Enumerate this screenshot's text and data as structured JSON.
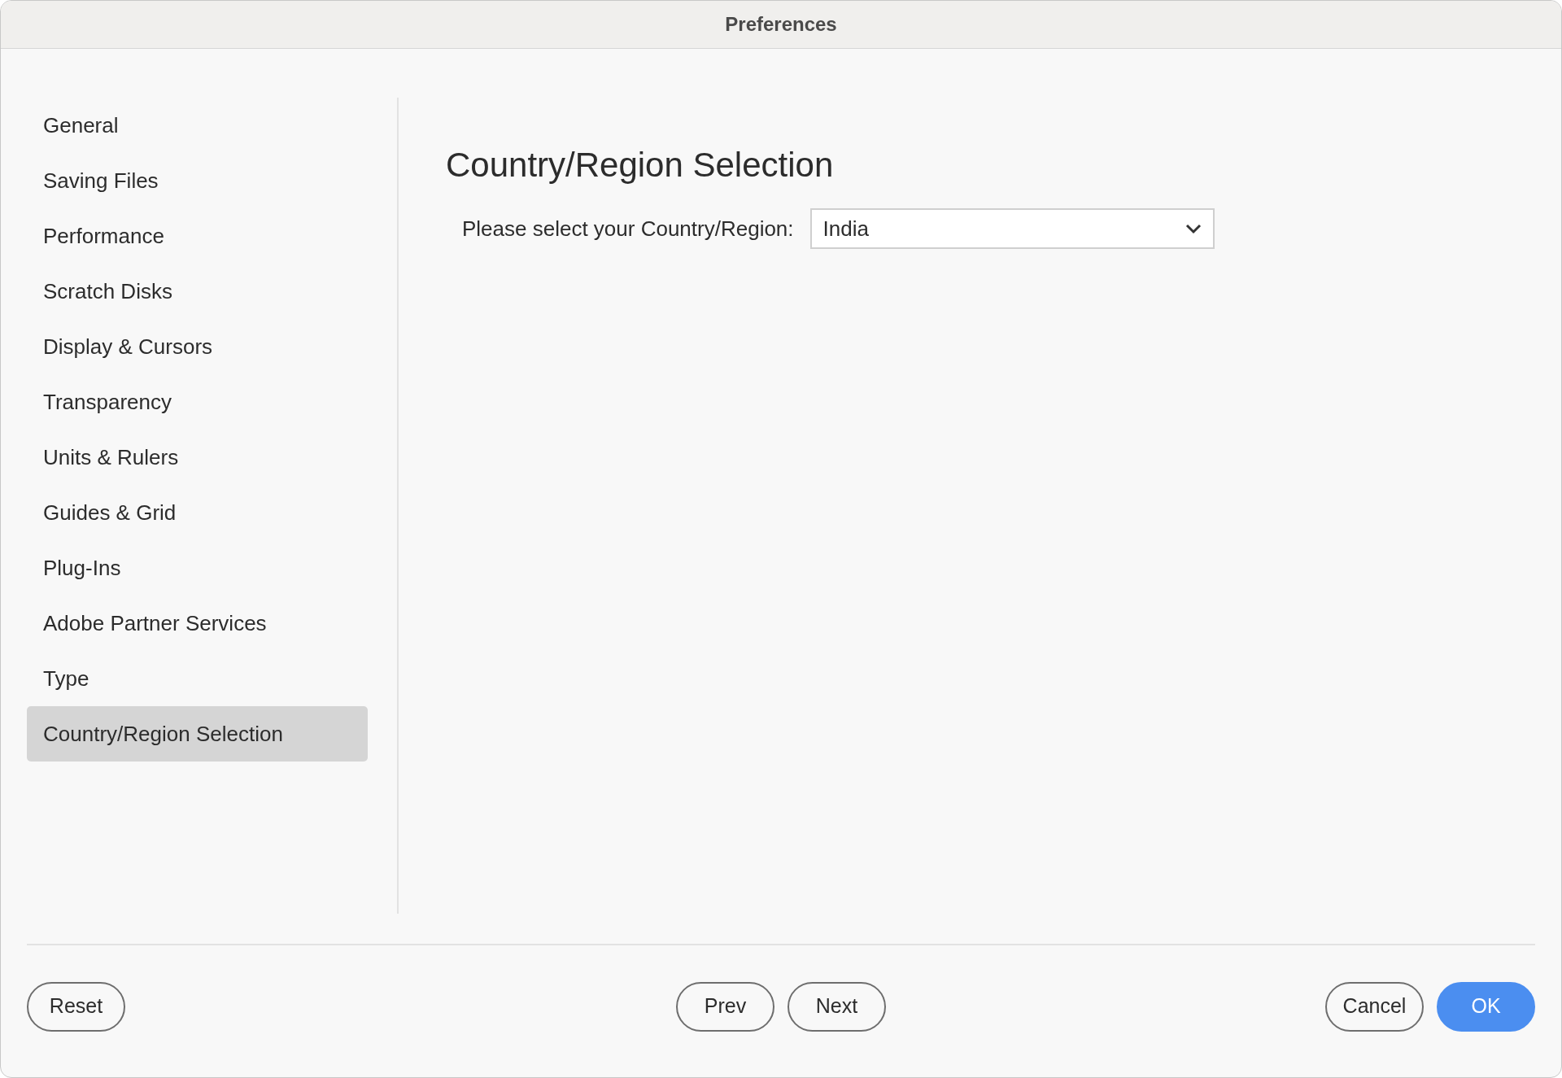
{
  "window": {
    "title": "Preferences"
  },
  "sidebar": {
    "items": [
      {
        "label": "General",
        "selected": false
      },
      {
        "label": "Saving Files",
        "selected": false
      },
      {
        "label": "Performance",
        "selected": false
      },
      {
        "label": "Scratch Disks",
        "selected": false
      },
      {
        "label": "Display & Cursors",
        "selected": false
      },
      {
        "label": "Transparency",
        "selected": false
      },
      {
        "label": "Units & Rulers",
        "selected": false
      },
      {
        "label": "Guides & Grid",
        "selected": false
      },
      {
        "label": "Plug-Ins",
        "selected": false
      },
      {
        "label": "Adobe Partner Services",
        "selected": false
      },
      {
        "label": "Type",
        "selected": false
      },
      {
        "label": "Country/Region Selection",
        "selected": true
      }
    ]
  },
  "panel": {
    "heading": "Country/Region Selection",
    "field_label": "Please select your Country/Region:",
    "dropdown": {
      "value": "India"
    }
  },
  "footer": {
    "left": [
      {
        "label": "Reset",
        "kind": "secondary"
      }
    ],
    "center": [
      {
        "label": "Prev",
        "kind": "secondary"
      },
      {
        "label": "Next",
        "kind": "secondary"
      }
    ],
    "right": [
      {
        "label": "Cancel",
        "kind": "secondary"
      },
      {
        "label": "OK",
        "kind": "primary"
      }
    ]
  }
}
